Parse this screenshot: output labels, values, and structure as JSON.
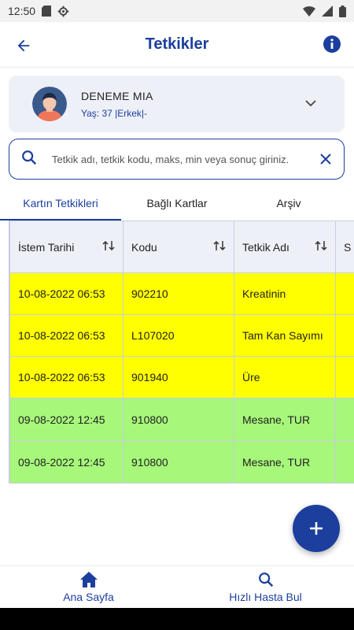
{
  "status_bar": {
    "time": "12:50",
    "icons": [
      "sd-card-icon",
      "gear-icon",
      "wifi-icon",
      "signal-icon",
      "battery-icon"
    ]
  },
  "app_bar": {
    "title": "Tetkikler",
    "back_icon": "arrow-left-icon",
    "info_icon": "info-icon"
  },
  "patient": {
    "name": "DENEME MIA",
    "meta": "Yaş: 37 |Erkek|-"
  },
  "search": {
    "placeholder": "Tetkik adı, tetkik kodu, maks, min veya sonuç giriniz.",
    "value": ""
  },
  "tabs": [
    {
      "label": "Kartın Tetkikleri",
      "active": true
    },
    {
      "label": "Bağlı Kartlar",
      "active": false
    },
    {
      "label": "Arşiv",
      "active": false
    }
  ],
  "table": {
    "headers": [
      "İstem Tarihi",
      "Kodu",
      "Tetkik Adı",
      "S"
    ],
    "rows": [
      {
        "date": "10-08-2022 06:53",
        "code": "902210",
        "name": "Kreatinin",
        "status_color": "yellow"
      },
      {
        "date": "10-08-2022 06:53",
        "code": "L107020",
        "name": "Tam Kan Sayımı",
        "status_color": "yellow"
      },
      {
        "date": "10-08-2022 06:53",
        "code": "901940",
        "name": "Üre",
        "status_color": "yellow"
      },
      {
        "date": "09-08-2022 12:45",
        "code": "910800",
        "name": "Mesane, TUR",
        "status_color": "green"
      },
      {
        "date": "09-08-2022 12:45",
        "code": "910800",
        "name": "Mesane, TUR",
        "status_color": "green"
      }
    ]
  },
  "bottom_nav": [
    {
      "label": "Ana Sayfa",
      "icon": "home-icon"
    },
    {
      "label": "Hızlı Hasta Bul",
      "icon": "search-icon"
    }
  ],
  "colors": {
    "primary": "#1c3f9e",
    "card_bg": "#eef0f8",
    "row_yellow": "#ffff00",
    "row_green": "#a6f77a"
  }
}
